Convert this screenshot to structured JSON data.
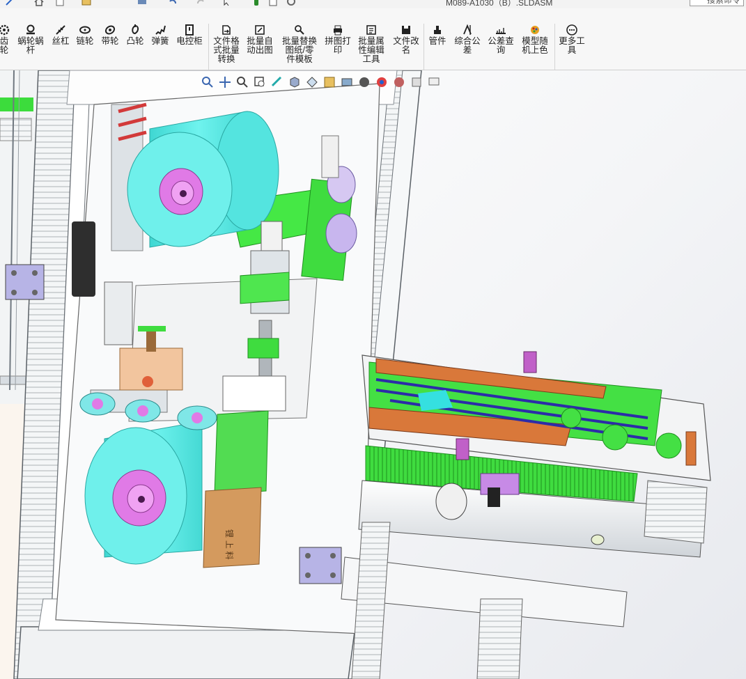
{
  "document": {
    "title": "M089-A1030（B）.SLDASM"
  },
  "search": {
    "placeholder": "搜索命令"
  },
  "ribbon": {
    "items": [
      {
        "id": "gear",
        "label": "齿\n轮",
        "icon": "gear-icon"
      },
      {
        "id": "worm",
        "label": "蜗轮蜗\n杆",
        "icon": "worm-gear-icon"
      },
      {
        "id": "leadscrew",
        "label": "丝杠",
        "icon": "lead-screw-icon"
      },
      {
        "id": "chain",
        "label": "链轮",
        "icon": "sprocket-icon"
      },
      {
        "id": "belt",
        "label": "带轮",
        "icon": "pulley-icon"
      },
      {
        "id": "cam",
        "label": "凸轮",
        "icon": "cam-icon"
      },
      {
        "id": "spring",
        "label": "弹簧",
        "icon": "spring-icon"
      },
      {
        "id": "cabinet",
        "label": "电控柜",
        "icon": "cabinet-icon"
      },
      {
        "id": "convert",
        "label": "文件格\n式批量\n转换",
        "icon": "file-convert-icon"
      },
      {
        "id": "autodraw",
        "label": "批量自\n动出图",
        "icon": "auto-drawing-icon"
      },
      {
        "id": "template",
        "label": "批量替换\n图纸/零\n件模板",
        "icon": "template-replace-icon"
      },
      {
        "id": "print",
        "label": "拼图打\n印",
        "icon": "print-icon"
      },
      {
        "id": "propedit",
        "label": "批量属\n性编辑\n工具",
        "icon": "property-edit-icon"
      },
      {
        "id": "rename",
        "label": "文件改\n名",
        "icon": "save-rename-icon"
      },
      {
        "id": "pipe",
        "label": "管件",
        "icon": "pipe-fitting-icon"
      },
      {
        "id": "tolerance",
        "label": "综合公\n差",
        "icon": "tolerance-icon"
      },
      {
        "id": "tollookup",
        "label": "公差查\n询",
        "icon": "tolerance-lookup-icon"
      },
      {
        "id": "randcolor",
        "label": "模型随\n机上色",
        "icon": "random-color-icon"
      },
      {
        "id": "more",
        "label": "更多工\n具",
        "icon": "more-tools-icon"
      }
    ]
  },
  "model_labels": {
    "spool_text": "锂  上 料"
  },
  "colors": {
    "roll": "#63efea",
    "hub": "#e07ae6",
    "frame": "#f1f3f5",
    "green": "#39e339",
    "orange": "#d9783a",
    "blue": "#2c2ca8",
    "bracket": "#b7b4e6"
  }
}
